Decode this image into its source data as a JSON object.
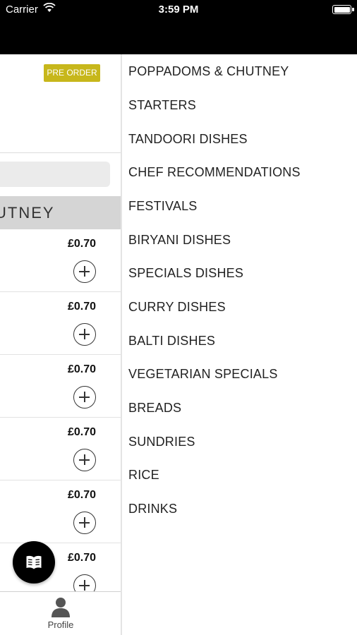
{
  "status_bar": {
    "carrier": "Carrier",
    "time": "3:59 PM"
  },
  "left_panel": {
    "badge": "PRE ORDER",
    "category_title": "UTNEY",
    "items": [
      {
        "price": "£0.70"
      },
      {
        "price": "£0.70"
      },
      {
        "price": "£0.70"
      },
      {
        "price": "£0.70"
      },
      {
        "price": "£0.70"
      },
      {
        "price": "£0.70"
      }
    ]
  },
  "tab_bar": {
    "profile_label": "Profile"
  },
  "side_menu": {
    "items": [
      "POPPADOMS & CHUTNEY",
      "STARTERS",
      "TANDOORI DISHES",
      "CHEF RECOMMENDATIONS",
      "FESTIVALS",
      "BIRYANI DISHES",
      "SPECIALS DISHES",
      "CURRY DISHES",
      "BALTI DISHES",
      "VEGETARIAN SPECIALS",
      "BREADS",
      "SUNDRIES",
      "RICE",
      "DRINKS"
    ]
  },
  "icons": {
    "wifi": "wifi-icon",
    "battery": "battery-icon",
    "add": "add-circle-icon",
    "profile": "profile-icon",
    "menu_book": "menu-book-icon"
  },
  "colors": {
    "badge_bg": "#c7b71b",
    "header_bg": "#000000",
    "category_bg": "#d5d5d5"
  }
}
